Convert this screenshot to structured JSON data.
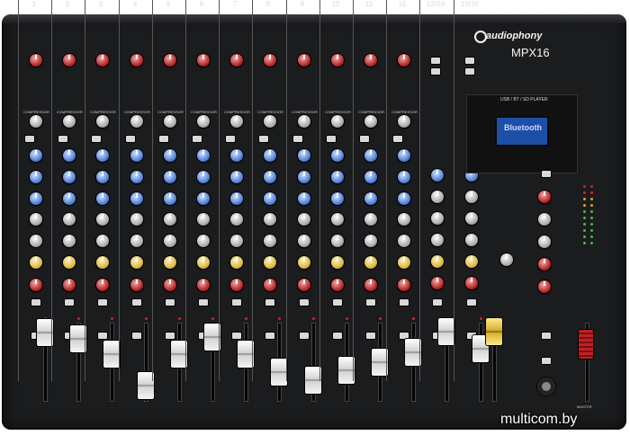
{
  "channels": {
    "labels": [
      "1",
      "2",
      "3",
      "4",
      "5",
      "6",
      "7",
      "8",
      "9",
      "10",
      "11",
      "12",
      "13/14",
      "15/16"
    ],
    "compressor_label": "COMPRESSOR",
    "fader_levels": [
      0.88,
      0.8,
      0.6,
      0.2,
      0.6,
      0.82,
      0.6,
      0.37,
      0.27,
      0.39,
      0.5,
      0.63,
      0.9,
      0.68
    ]
  },
  "master": {
    "fader_level": 0.73,
    "aux_fader_level": 0.9,
    "label": "MASTER"
  },
  "brand": {
    "name": "audiophony",
    "model": "MPX16"
  },
  "player": {
    "title": "USB / BT / SD PLAYER",
    "display": "Bluetooth"
  },
  "footer": {
    "watermark": "multicom.by"
  },
  "colors": {
    "body": "#1b1c1e",
    "knob_red": "#b32424",
    "knob_blue": "#4f7fd6",
    "knob_grey": "#a9a9a9",
    "knob_yellow": "#d8b640",
    "lcd": "#1d4fa8"
  }
}
